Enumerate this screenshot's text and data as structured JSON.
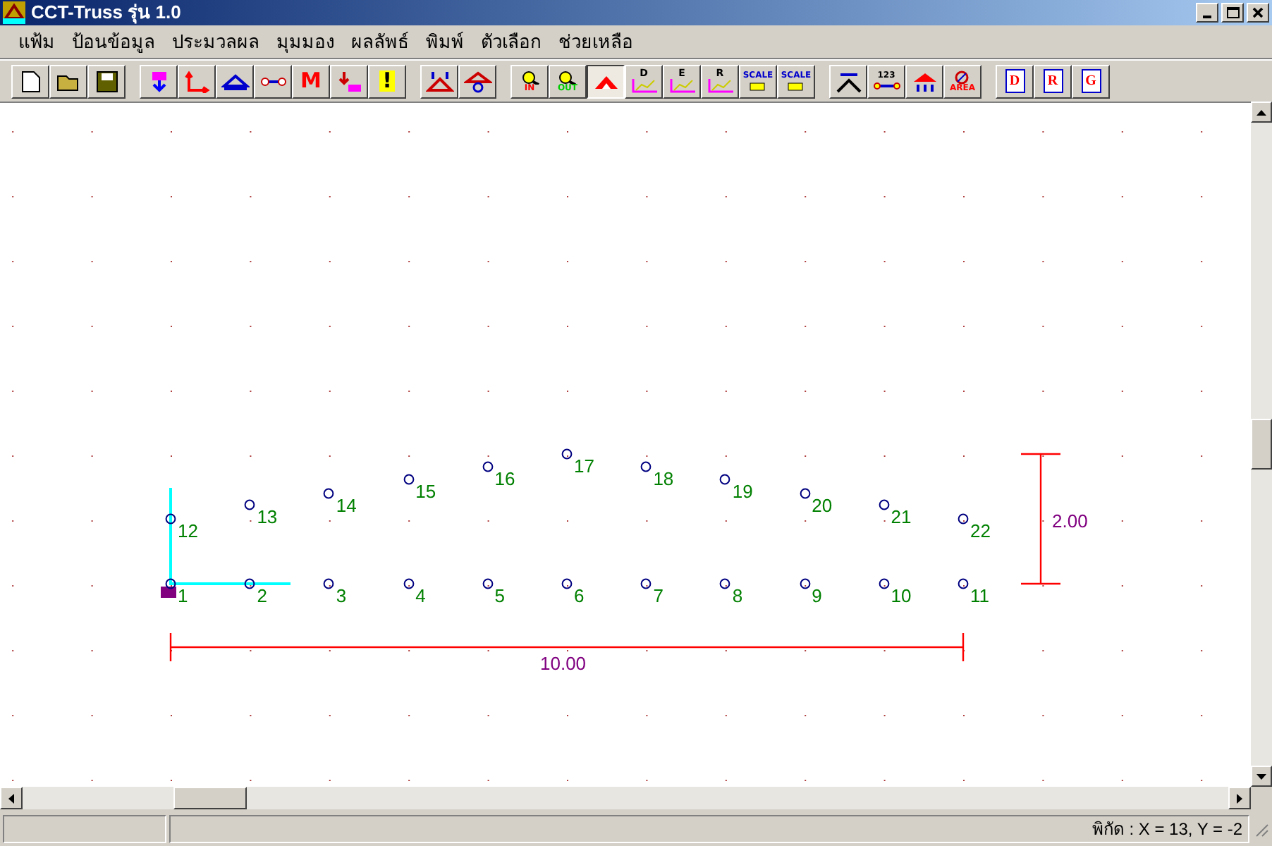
{
  "window": {
    "title": "CCT-Truss รุ่น 1.0"
  },
  "menu": [
    {
      "label": "แฟ้ม"
    },
    {
      "label": "ป้อนข้อมูล"
    },
    {
      "label": "ประมวลผล"
    },
    {
      "label": "มุมมอง"
    },
    {
      "label": "ผลลัพธ์"
    },
    {
      "label": "พิมพ์"
    },
    {
      "label": "ตัวเลือก"
    },
    {
      "label": "ช่วยเหลือ"
    }
  ],
  "toolbar": [
    [
      {
        "kind": "new",
        "pressed": false
      },
      {
        "kind": "open",
        "pressed": false
      },
      {
        "kind": "save",
        "pressed": false
      }
    ],
    [
      {
        "kind": "load",
        "pressed": false
      },
      {
        "kind": "axes",
        "pressed": false
      },
      {
        "kind": "support",
        "pressed": false
      },
      {
        "kind": "member",
        "pressed": false
      },
      {
        "kind": "letter",
        "label": "M",
        "pressed": false
      },
      {
        "kind": "point",
        "pressed": false
      },
      {
        "kind": "letter",
        "label": "!",
        "pressed": false
      }
    ],
    [
      {
        "kind": "truss-load",
        "pressed": false
      },
      {
        "kind": "truss-node",
        "pressed": false
      }
    ],
    [
      {
        "kind": "zoom",
        "label": "IN",
        "pressed": false
      },
      {
        "kind": "zoom",
        "label": "OUT",
        "pressed": false
      },
      {
        "kind": "truss",
        "pressed": true
      },
      {
        "kind": "graph",
        "label": "D",
        "pressed": false
      },
      {
        "kind": "graph",
        "label": "E",
        "pressed": false
      },
      {
        "kind": "graph",
        "label": "R",
        "pressed": false
      },
      {
        "kind": "scale",
        "label": "SCALE",
        "pressed": false
      },
      {
        "kind": "scale",
        "label": "SCALE",
        "pressed": false
      }
    ],
    [
      {
        "kind": "dimension",
        "pressed": false
      },
      {
        "kind": "numbering",
        "label": "123",
        "pressed": false
      },
      {
        "kind": "reaction",
        "pressed": false
      },
      {
        "kind": "area",
        "label": "AREA",
        "pressed": false
      }
    ],
    [
      {
        "kind": "doc",
        "label": "D",
        "pressed": false
      },
      {
        "kind": "doc",
        "label": "R",
        "pressed": false
      },
      {
        "kind": "doc",
        "label": "G",
        "pressed": false
      }
    ]
  ],
  "canvas": {
    "nodes": [
      {
        "label": "1"
      },
      {
        "label": "2"
      },
      {
        "label": "3"
      },
      {
        "label": "4"
      },
      {
        "label": "5"
      },
      {
        "label": "6"
      },
      {
        "label": "7"
      },
      {
        "label": "8"
      },
      {
        "label": "9"
      },
      {
        "label": "10"
      },
      {
        "label": "11"
      },
      {
        "label": "12"
      },
      {
        "label": "13"
      },
      {
        "label": "14"
      },
      {
        "label": "15"
      },
      {
        "label": "16"
      },
      {
        "label": "17"
      },
      {
        "label": "18"
      },
      {
        "label": "19"
      },
      {
        "label": "20"
      },
      {
        "label": "21"
      },
      {
        "label": "22"
      }
    ],
    "span_dimension": "10.00",
    "rise_dimension": "2.00"
  },
  "status_bar": {
    "coordinates": "พิกัด : X = 13, Y = -2"
  }
}
